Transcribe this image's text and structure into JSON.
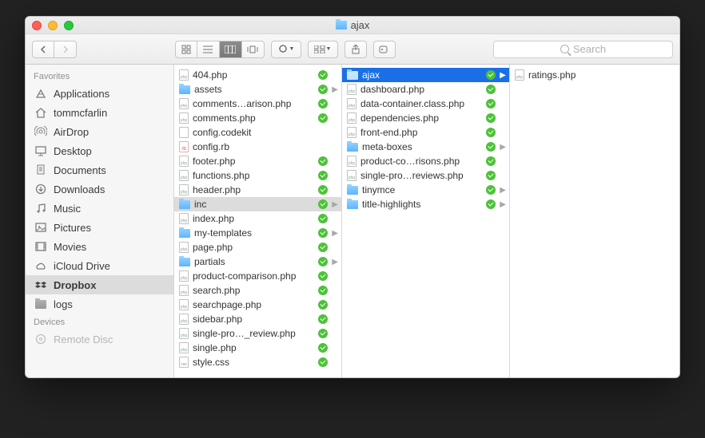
{
  "window_title": "ajax",
  "search_placeholder": "Search",
  "sidebar": {
    "sections": [
      {
        "title": "Favorites",
        "items": [
          {
            "icon": "apps",
            "label": "Applications"
          },
          {
            "icon": "home",
            "label": "tommcfarlin"
          },
          {
            "icon": "airdrop",
            "label": "AirDrop"
          },
          {
            "icon": "desktop",
            "label": "Desktop"
          },
          {
            "icon": "documents",
            "label": "Documents"
          },
          {
            "icon": "downloads",
            "label": "Downloads"
          },
          {
            "icon": "music",
            "label": "Music"
          },
          {
            "icon": "pictures",
            "label": "Pictures"
          },
          {
            "icon": "movies",
            "label": "Movies"
          },
          {
            "icon": "cloud",
            "label": "iCloud Drive"
          },
          {
            "icon": "dropbox",
            "label": "Dropbox",
            "selected": true
          },
          {
            "icon": "folder",
            "label": "logs"
          }
        ]
      },
      {
        "title": "Devices",
        "items": [
          {
            "icon": "disc",
            "label": "Remote Disc",
            "faded": true
          }
        ]
      }
    ]
  },
  "columns": [
    [
      {
        "name": "404.php",
        "type": "php",
        "sync": true
      },
      {
        "name": "assets",
        "type": "folder",
        "sync": true,
        "expand": true
      },
      {
        "name": "comments…arison.php",
        "type": "php",
        "sync": true
      },
      {
        "name": "comments.php",
        "type": "php",
        "sync": true
      },
      {
        "name": "config.codekit",
        "type": "blank"
      },
      {
        "name": "config.rb",
        "type": "rb"
      },
      {
        "name": "footer.php",
        "type": "php",
        "sync": true
      },
      {
        "name": "functions.php",
        "type": "php",
        "sync": true
      },
      {
        "name": "header.php",
        "type": "php",
        "sync": true
      },
      {
        "name": "inc",
        "type": "folder",
        "sync": true,
        "expand": true,
        "selected": "gray"
      },
      {
        "name": "index.php",
        "type": "php",
        "sync": true
      },
      {
        "name": "my-templates",
        "type": "folder",
        "sync": true,
        "expand": true
      },
      {
        "name": "page.php",
        "type": "php",
        "sync": true
      },
      {
        "name": "partials",
        "type": "folder",
        "sync": true,
        "expand": true
      },
      {
        "name": "product-comparison.php",
        "type": "php",
        "sync": true
      },
      {
        "name": "search.php",
        "type": "php",
        "sync": true
      },
      {
        "name": "searchpage.php",
        "type": "php",
        "sync": true
      },
      {
        "name": "sidebar.php",
        "type": "php",
        "sync": true
      },
      {
        "name": "single-pro…_review.php",
        "type": "php",
        "sync": true
      },
      {
        "name": "single.php",
        "type": "php",
        "sync": true
      },
      {
        "name": "style.css",
        "type": "css",
        "sync": true
      }
    ],
    [
      {
        "name": "ajax",
        "type": "folder",
        "sync": true,
        "expand": true,
        "selected": "blue"
      },
      {
        "name": "dashboard.php",
        "type": "php",
        "sync": true
      },
      {
        "name": "data-container.class.php",
        "type": "php",
        "sync": true
      },
      {
        "name": "dependencies.php",
        "type": "php",
        "sync": true
      },
      {
        "name": "front-end.php",
        "type": "php",
        "sync": true
      },
      {
        "name": "meta-boxes",
        "type": "folder",
        "sync": true,
        "expand": true
      },
      {
        "name": "product-co…risons.php",
        "type": "php",
        "sync": true
      },
      {
        "name": "single-pro…reviews.php",
        "type": "php",
        "sync": true
      },
      {
        "name": "tinymce",
        "type": "folder",
        "sync": true,
        "expand": true
      },
      {
        "name": "title-highlights",
        "type": "folder",
        "sync": true,
        "expand": true
      }
    ],
    [
      {
        "name": "ratings.php",
        "type": "php"
      }
    ]
  ]
}
